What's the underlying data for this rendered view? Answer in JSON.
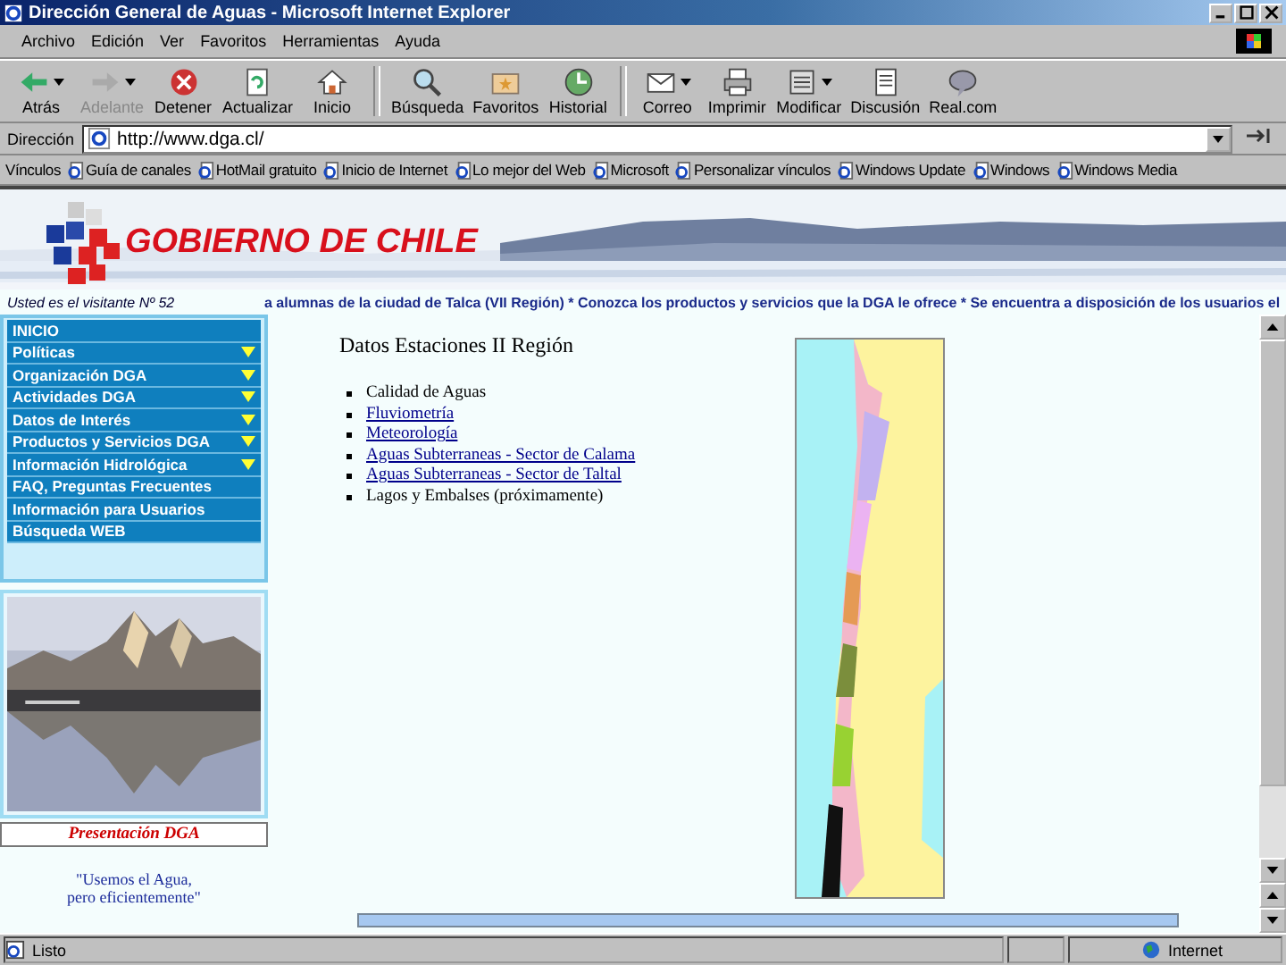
{
  "window": {
    "title": "Dirección General de Aguas - Microsoft Internet Explorer"
  },
  "menu": [
    "Archivo",
    "Edición",
    "Ver",
    "Favoritos",
    "Herramientas",
    "Ayuda"
  ],
  "toolbar": {
    "groups": [
      [
        {
          "label": "Atrás",
          "disabled": false,
          "dropdown": true
        },
        {
          "label": "Adelante",
          "disabled": true,
          "dropdown": true
        },
        {
          "label": "Detener",
          "disabled": false,
          "dropdown": false
        },
        {
          "label": "Actualizar",
          "disabled": false,
          "dropdown": false
        },
        {
          "label": "Inicio",
          "disabled": false,
          "dropdown": false
        }
      ],
      [
        {
          "label": "Búsqueda",
          "disabled": false,
          "dropdown": false
        },
        {
          "label": "Favoritos",
          "disabled": false,
          "dropdown": false
        },
        {
          "label": "Historial",
          "disabled": false,
          "dropdown": false
        }
      ],
      [
        {
          "label": "Correo",
          "disabled": false,
          "dropdown": true
        },
        {
          "label": "Imprimir",
          "disabled": false,
          "dropdown": false
        },
        {
          "label": "Modificar",
          "disabled": false,
          "dropdown": true
        },
        {
          "label": "Discusión",
          "disabled": false,
          "dropdown": false
        },
        {
          "label": "Real.com",
          "disabled": false,
          "dropdown": false
        }
      ]
    ]
  },
  "address": {
    "label": "Dirección",
    "value": "http://www.dga.cl/"
  },
  "links": {
    "label": "Vínculos",
    "items": [
      "Guía de canales",
      "HotMail gratuito",
      "Inicio de Internet",
      "Lo mejor del Web",
      "Microsoft",
      "Personalizar vínculos",
      "Windows Update",
      "Windows",
      "Windows Media"
    ]
  },
  "banner": {
    "logo_text": "GOBIERNO DE CHILE"
  },
  "visitor": "Usted es el visitante Nº 52",
  "ticker": "a alumnas de la ciudad de Talca (VII Región)   *   Conozca los productos y servicios que la DGA le ofrece   *   Se encuentra a disposición de los usuarios el",
  "sidebar": {
    "items": [
      {
        "label": "INICIO",
        "submenu": false
      },
      {
        "label": "Políticas",
        "submenu": true
      },
      {
        "label": "Organización DGA",
        "submenu": true
      },
      {
        "label": "Actividades DGA",
        "submenu": true
      },
      {
        "label": "Datos de Interés",
        "submenu": true
      },
      {
        "label": "Productos y Servicios DGA",
        "submenu": true
      },
      {
        "label": "Información Hidrológica",
        "submenu": true
      },
      {
        "label": "FAQ, Preguntas Frecuentes",
        "submenu": false
      },
      {
        "label": "Información para Usuarios",
        "submenu": false
      },
      {
        "label": "Búsqueda WEB",
        "submenu": false
      }
    ],
    "caption": "Presentación DGA",
    "quote": [
      "\"Usemos el Agua,",
      "pero eficientemente\""
    ]
  },
  "content": {
    "title": "Datos Estaciones II Región",
    "items": [
      {
        "text": "Calidad de Aguas",
        "link": false
      },
      {
        "text": "Fluviometría",
        "link": true
      },
      {
        "text": "Meteorología",
        "link": true
      },
      {
        "text": "Aguas Subterraneas - Sector de Calama",
        "link": true
      },
      {
        "text": "Aguas Subterraneas - Sector de Taltal",
        "link": true
      },
      {
        "text": "Lagos y Embalses (próximamente)",
        "link": false
      }
    ]
  },
  "status_bar": {
    "text": "Listo",
    "zone": "Internet"
  }
}
